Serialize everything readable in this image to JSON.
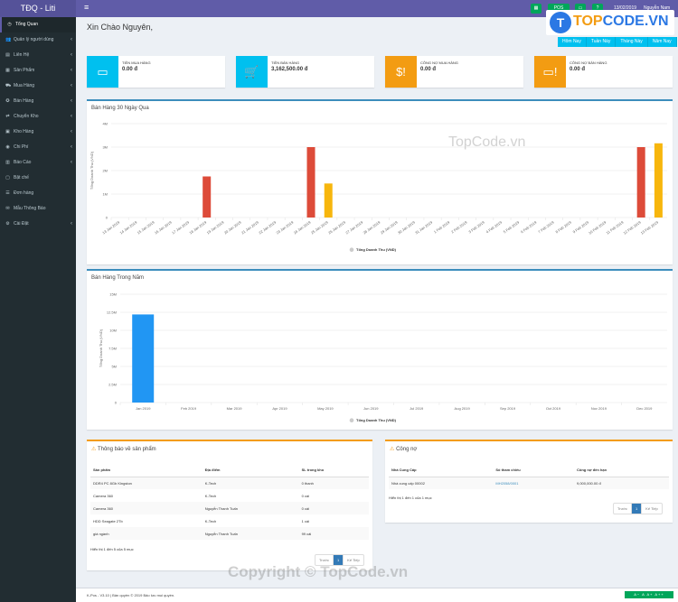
{
  "app": {
    "logo": "TĐQ - Liti",
    "date": "13/02/2019",
    "user": "Nguyễn Nam",
    "cart_badge": "0",
    "pos_label": "POS"
  },
  "menu": {
    "toggle": "≡"
  },
  "sidebar": {
    "items": [
      {
        "label": "Tổng Quan",
        "icon": "dashboard-icon",
        "glyph": "◷",
        "active": true,
        "chevron": false
      },
      {
        "label": "Quản lý người dùng",
        "icon": "users-icon",
        "glyph": "👥",
        "chevron": true
      },
      {
        "label": "Liên Hệ",
        "icon": "book-icon",
        "glyph": "▤",
        "chevron": true
      },
      {
        "label": "Sản Phẩm",
        "icon": "box-icon",
        "glyph": "▦",
        "chevron": true
      },
      {
        "label": "Mua Hàng",
        "icon": "cart-icon",
        "glyph": "⛟",
        "chevron": true
      },
      {
        "label": "Bán Hàng",
        "icon": "tag-icon",
        "glyph": "✪",
        "chevron": true
      },
      {
        "label": "Chuyển Kho",
        "icon": "truck-icon",
        "glyph": "⇄",
        "chevron": true
      },
      {
        "label": "Kho Hàng",
        "icon": "warehouse-icon",
        "glyph": "▣",
        "chevron": true
      },
      {
        "label": "Chi Phí",
        "icon": "money-icon",
        "glyph": "◉",
        "chevron": true
      },
      {
        "label": "Báo Cáo",
        "icon": "chart-icon",
        "glyph": "▥",
        "chevron": true
      },
      {
        "label": "Bật chế",
        "icon": "file-icon",
        "glyph": "▢",
        "chevron": false
      },
      {
        "label": "Đơn hàng",
        "icon": "list-icon",
        "glyph": "☰",
        "chevron": false
      },
      {
        "label": "Mẫu Thông Báo",
        "icon": "envelope-icon",
        "glyph": "✉",
        "chevron": false
      },
      {
        "label": "Cài Đặt",
        "icon": "gear-icon",
        "glyph": "⚙",
        "chevron": true
      }
    ]
  },
  "main": {
    "welcome": "Xin Chào Nguyên,",
    "period_buttons": [
      "Hôm Nay",
      "Tuần Này",
      "Tháng Này",
      "Năm Nay"
    ],
    "stats": [
      {
        "label": "TIỀN MUA HÀNG",
        "value": "0.00 đ",
        "color": "#00c0ef",
        "icon": "money-bill-icon",
        "glyph": "▭"
      },
      {
        "label": "TIỀN BÁN HÀNG",
        "value": "3,162,500.00 đ",
        "color": "#00c0ef",
        "icon": "shopping-cart-icon",
        "glyph": "🛒"
      },
      {
        "label": "CÔNG NỢ MUA HÀNG",
        "value": "0.00 đ",
        "color": "#f39c12",
        "icon": "dollar-alert-icon",
        "glyph": "$!"
      },
      {
        "label": "CÔNG NỢ BÁN HÀNG",
        "value": "0.00 đ",
        "color": "#f39c12",
        "icon": "doc-alert-icon",
        "glyph": "▭!"
      }
    ]
  },
  "chart_data": [
    {
      "type": "bar",
      "title": "Bán Hàng 30 Ngày Qua",
      "ylabel": "Tổng Doanh Thu (VND)",
      "legend": "Tổng Doanh Thu (VND)",
      "legend_position": "bottom",
      "yticks": [
        "0",
        "1M",
        "2M",
        "3M",
        "4M"
      ],
      "ylim": [
        0,
        4000000
      ],
      "categories": [
        "13 Jan 2019",
        "14 Jan 2019",
        "15 Jan 2019",
        "16 Jan 2019",
        "17 Jan 2019",
        "18 Jan 2019",
        "19 Jan 2019",
        "20 Jan 2019",
        "21 Jan 2019",
        "22 Jan 2019",
        "23 Jan 2019",
        "24 Jan 2019",
        "25 Jan 2019",
        "26 Jan 2019",
        "27 Jan 2019",
        "28 Jan 2019",
        "29 Jan 2019",
        "30 Jan 2019",
        "31 Jan 2019",
        "1 Feb 2019",
        "2 Feb 2019",
        "3 Feb 2019",
        "4 Feb 2019",
        "5 Feb 2019",
        "6 Feb 2019",
        "7 Feb 2019",
        "8 Feb 2019",
        "9 Feb 2019",
        "10 Feb 2019",
        "11 Feb 2019",
        "12 Feb 2019",
        "13 Feb 2019"
      ],
      "values": [
        0,
        0,
        0,
        0,
        0,
        1750000,
        0,
        0,
        0,
        0,
        0,
        3000000,
        1450000,
        0,
        0,
        0,
        0,
        0,
        0,
        0,
        0,
        0,
        0,
        0,
        0,
        0,
        0,
        0,
        0,
        0,
        3000000,
        3162500
      ],
      "colors": [
        "",
        "",
        "",
        "",
        "",
        "#dd4b39",
        "",
        "",
        "",
        "",
        "",
        "#dd4b39",
        "#f7b60d",
        "",
        "",
        "",
        "",
        "",
        "",
        "",
        "",
        "",
        "",
        "",
        "",
        "",
        "",
        "",
        "",
        "",
        "#dd4b39",
        "#f7b60d"
      ]
    },
    {
      "type": "bar",
      "title": "Bán Hàng Trong Năm",
      "ylabel": "Tổng Doanh Thu (VND)",
      "legend": "Tổng Doanh Thu (VND)",
      "legend_position": "bottom",
      "yticks": [
        "0",
        "2.5M",
        "5M",
        "7.5M",
        "10M",
        "12.5M",
        "15M"
      ],
      "ylim": [
        0,
        15000000
      ],
      "categories": [
        "Jan 2019",
        "Feb 2019",
        "Mar 2019",
        "Apr 2019",
        "May 2019",
        "Jun 2019",
        "Jul 2019",
        "Aug 2019",
        "Sep 2019",
        "Oct 2019",
        "Nov 2019",
        "Dec 2019"
      ],
      "values": [
        12200000,
        0,
        0,
        0,
        0,
        0,
        0,
        0,
        0,
        0,
        0,
        0
      ],
      "colors": [
        "#2196f3",
        "",
        "",
        "",
        "",
        "",
        "",
        "",
        "",
        "",
        "",
        ""
      ]
    }
  ],
  "products_panel": {
    "title": "Thông báo về sản phẩm",
    "icon": "warning-icon",
    "headers": [
      "Sản phẩm",
      "Địa điểm",
      "SL trong kho"
    ],
    "rows": [
      [
        "DDR4 PC 8Gb Kingston",
        "K-Tech",
        "0 thanh"
      ],
      [
        "Camera 360",
        "K-Tech",
        "0 cái"
      ],
      [
        "Camera 360",
        "Nguyễn Thanh Tuấn",
        "0 cái"
      ],
      [
        "HDD Seagate 2Tb",
        "K-Tech",
        "1 cái"
      ],
      [
        "giá ngành",
        "Nguyễn Thanh Tuấn",
        "99 cái"
      ]
    ],
    "info": "Hiển thị 1 đến 5 của 5 mục",
    "prev": "Trước",
    "page": "1",
    "next": "Kế Tiếp"
  },
  "debt_panel": {
    "title": "Công nợ",
    "icon": "warning-icon",
    "headers": [
      "Nhà Cung Cấp",
      "Số tham chiếu",
      "Công nợ đến hạn"
    ],
    "rows": [
      [
        "Nhà cung cấp 00002",
        "MH2058/0001",
        "9,000,000.00 đ"
      ]
    ],
    "info": "Hiển thị 1 đến 1 của 1 mục",
    "prev": "Trước",
    "page": "1",
    "next": "Kế Tiếp"
  },
  "footer": {
    "text": "K-Pos - V3.10 | Bản quyền © 2019 Bảo lưu mọi quyền.",
    "font_tools": "A− A A+ A++"
  },
  "watermark": {
    "text": "Copyright © TopCode.vn",
    "mid": "TopCode.vn",
    "logo_t": "T",
    "logo_top": "TOP",
    "logo_rest": "CODE.VN"
  }
}
